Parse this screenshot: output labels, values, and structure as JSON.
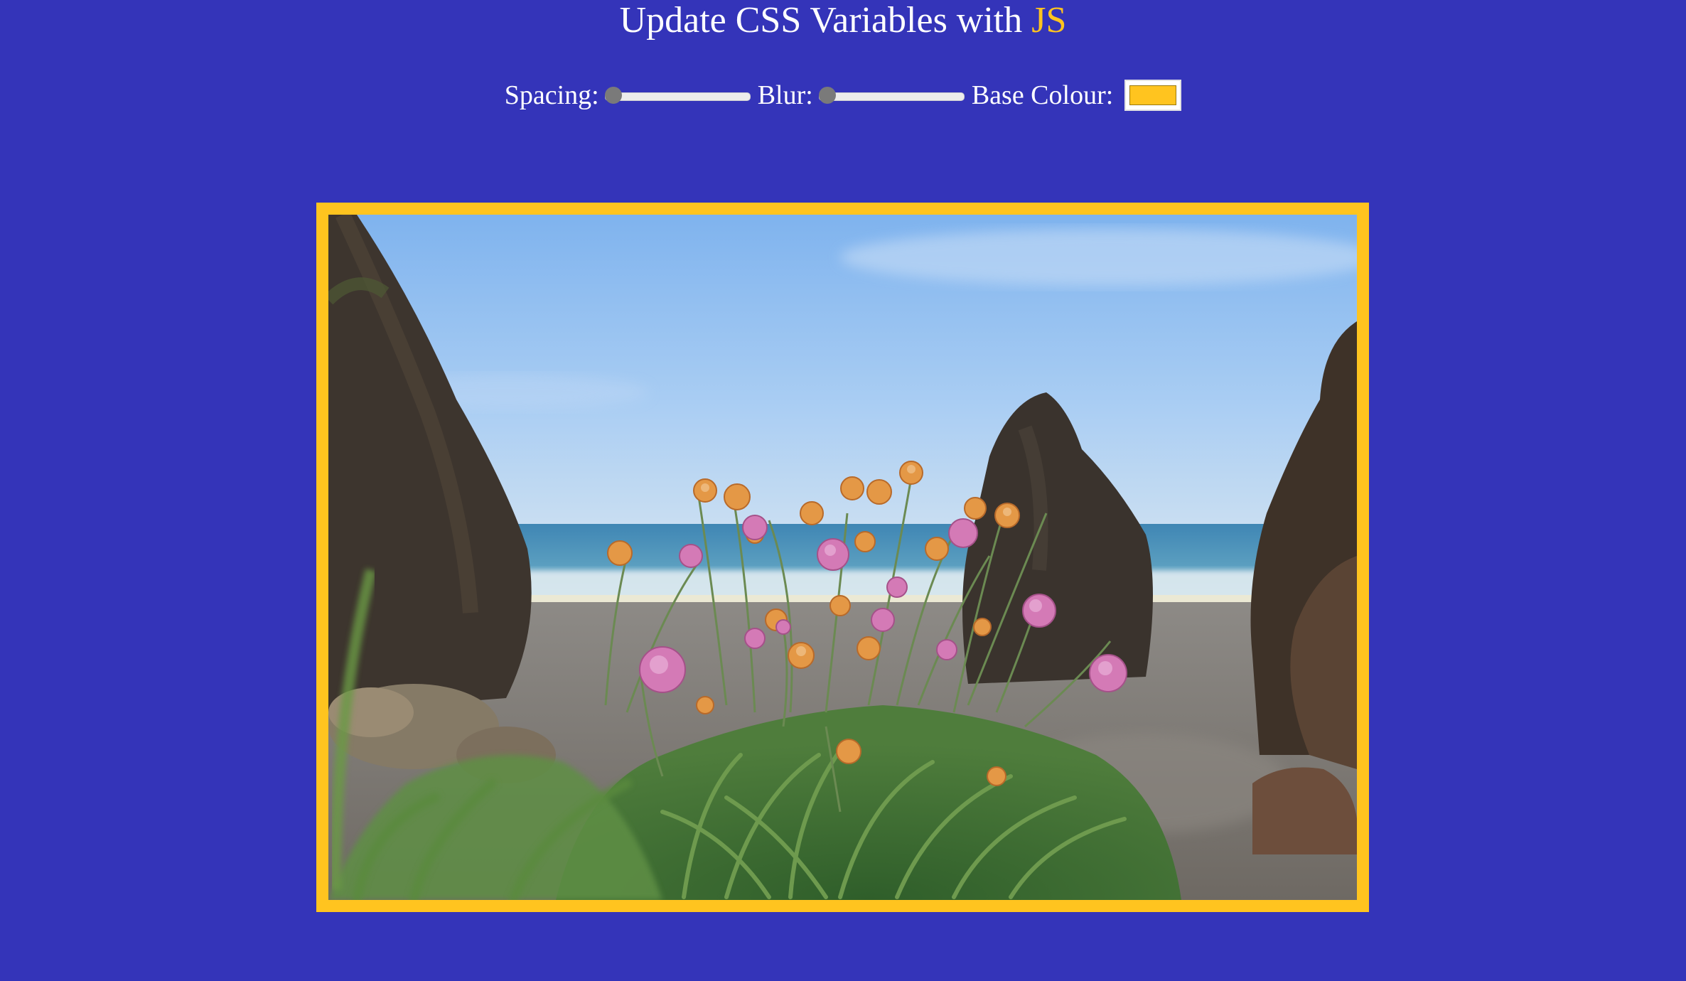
{
  "header": {
    "title_prefix": "Update CSS Variables with",
    "title_accent": "JS"
  },
  "controls": {
    "spacing_label": "Spacing:",
    "blur_label": "Blur:",
    "base_colour_label": "Base Colour:",
    "base_colour_value": "#ffc41f"
  },
  "colors": {
    "background": "#3434b9",
    "accent": "#ffc41f",
    "text": "#ffffff"
  },
  "photo": {
    "subject": "pink and orange sea thrift flowers on a rocky beach with the sea behind"
  }
}
